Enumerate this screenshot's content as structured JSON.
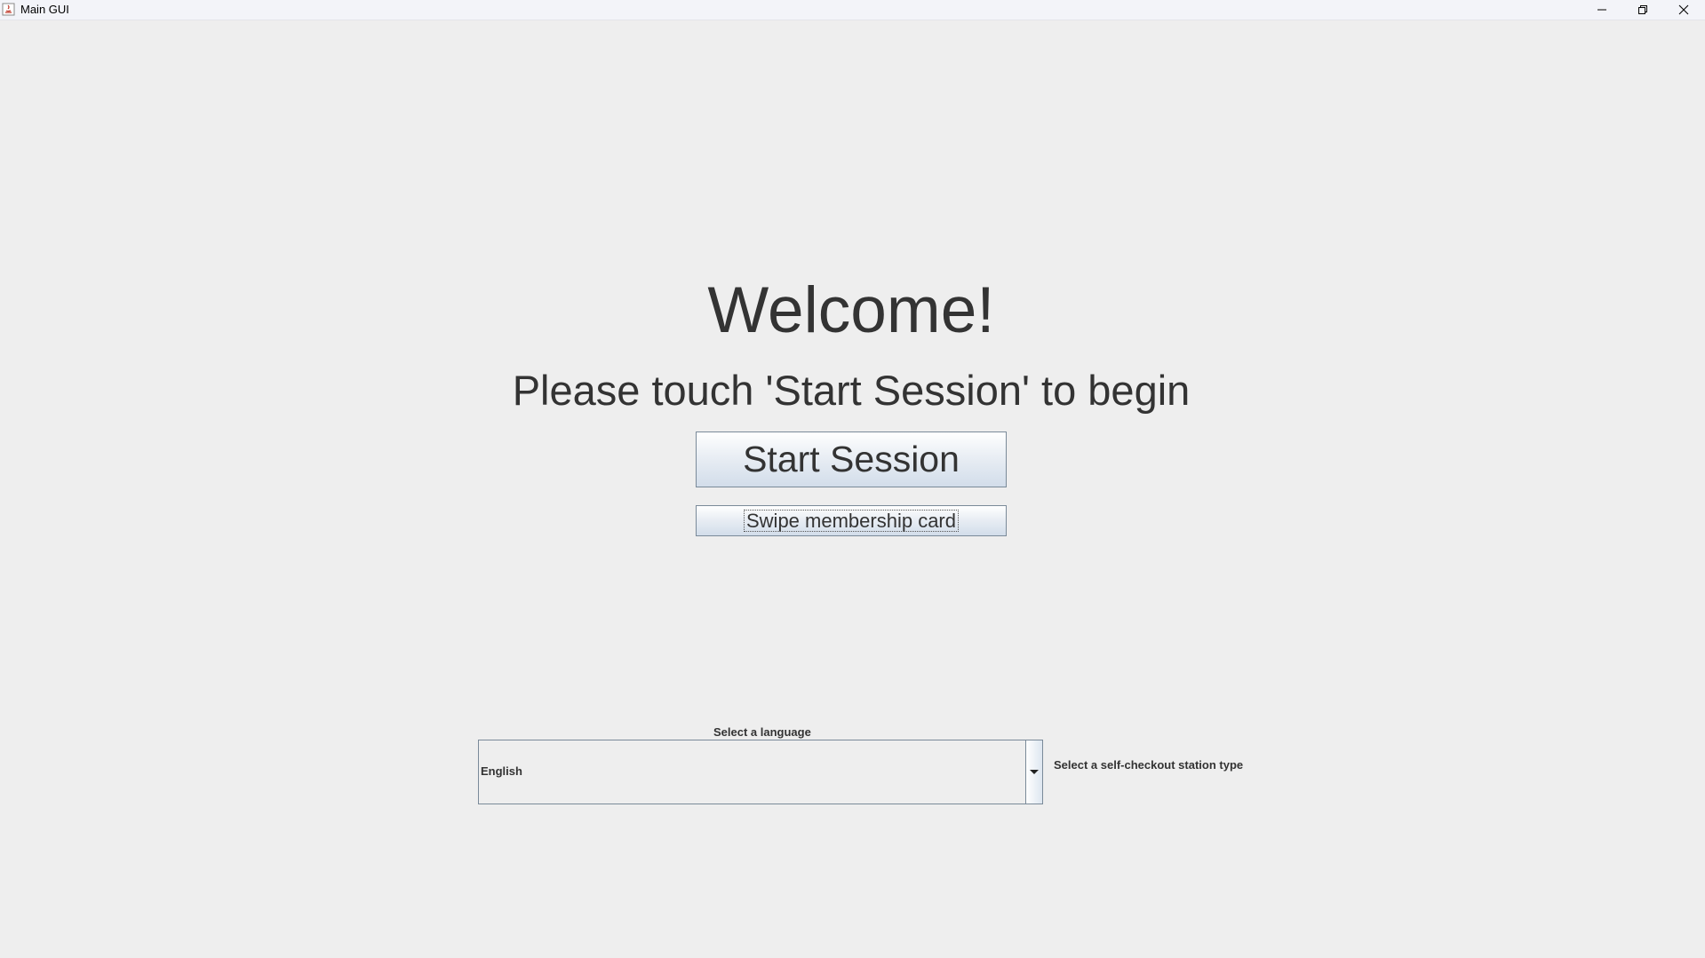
{
  "window": {
    "title": "Main GUI"
  },
  "main": {
    "welcome": "Welcome!",
    "instruction": "Please touch 'Start Session' to begin",
    "start_button": "Start Session",
    "swipe_button": "Swipe membership card"
  },
  "settings": {
    "language_label": "Select a language",
    "language_value": "English",
    "station_type_label": "Select a self-checkout station type"
  },
  "icons": {
    "app": "java-icon",
    "minimize": "minimize-icon",
    "maximize": "restore-icon",
    "close": "close-icon",
    "dropdown": "chevron-down-icon"
  }
}
